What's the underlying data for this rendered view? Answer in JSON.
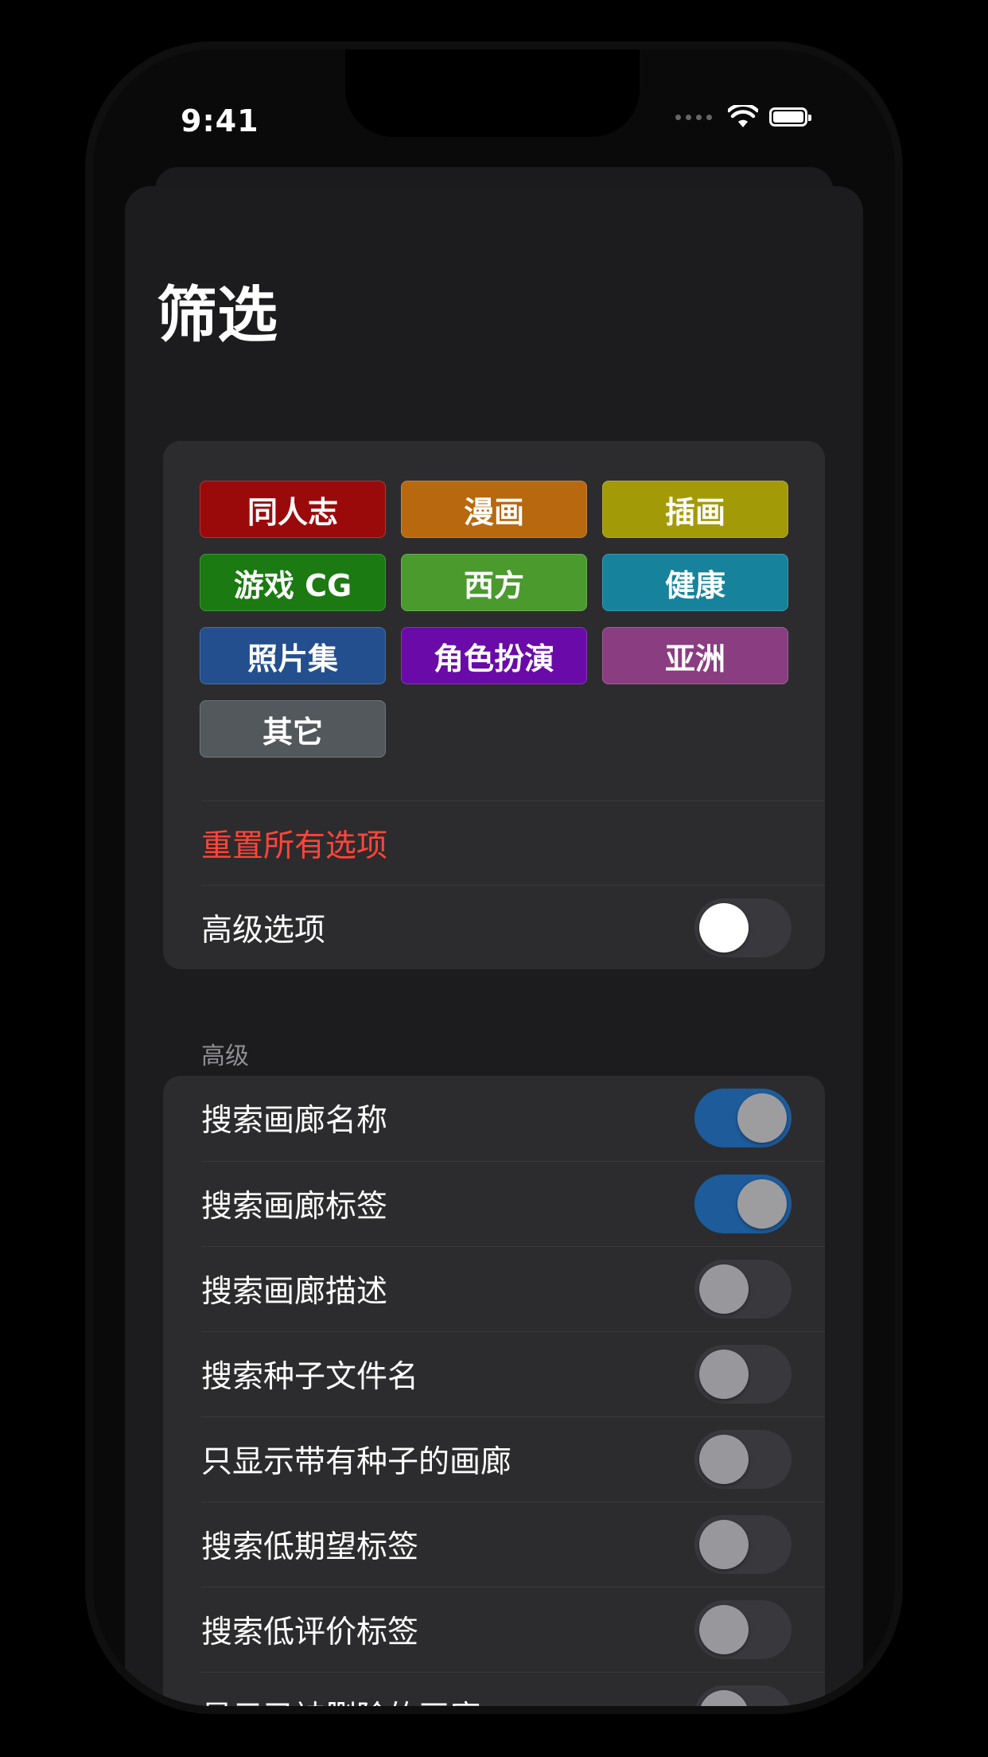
{
  "status_bar": {
    "time": "9:41"
  },
  "sheet": {
    "title": "筛选",
    "categories": [
      {
        "label": "同人志",
        "color": "#9b0a0a"
      },
      {
        "label": "漫画",
        "color": "#b8680f"
      },
      {
        "label": "插画",
        "color": "#a39a08"
      },
      {
        "label": "游戏 CG",
        "color": "#1b7a12"
      },
      {
        "label": "西方",
        "color": "#4a9a2e"
      },
      {
        "label": "健康",
        "color": "#16829b"
      },
      {
        "label": "照片集",
        "color": "#234f8e"
      },
      {
        "label": "角色扮演",
        "color": "#6a0aa8"
      },
      {
        "label": "亚洲",
        "color": "#8a3d80"
      },
      {
        "label": "其它",
        "color": "#53585c"
      }
    ],
    "reset_label": "重置所有选项",
    "advanced_toggle": {
      "label": "高级选项",
      "on": false
    },
    "advanced_section": {
      "header": "高级",
      "options": [
        {
          "label": "搜索画廊名称",
          "on": true
        },
        {
          "label": "搜索画廊标签",
          "on": true
        },
        {
          "label": "搜索画廊描述",
          "on": false
        },
        {
          "label": "搜索种子文件名",
          "on": false
        },
        {
          "label": "只显示带有种子的画廊",
          "on": false
        },
        {
          "label": "搜索低期望标签",
          "on": false
        },
        {
          "label": "搜索低评价标签",
          "on": false
        },
        {
          "label": "显示已被删除的画廊",
          "on": false
        }
      ]
    }
  }
}
